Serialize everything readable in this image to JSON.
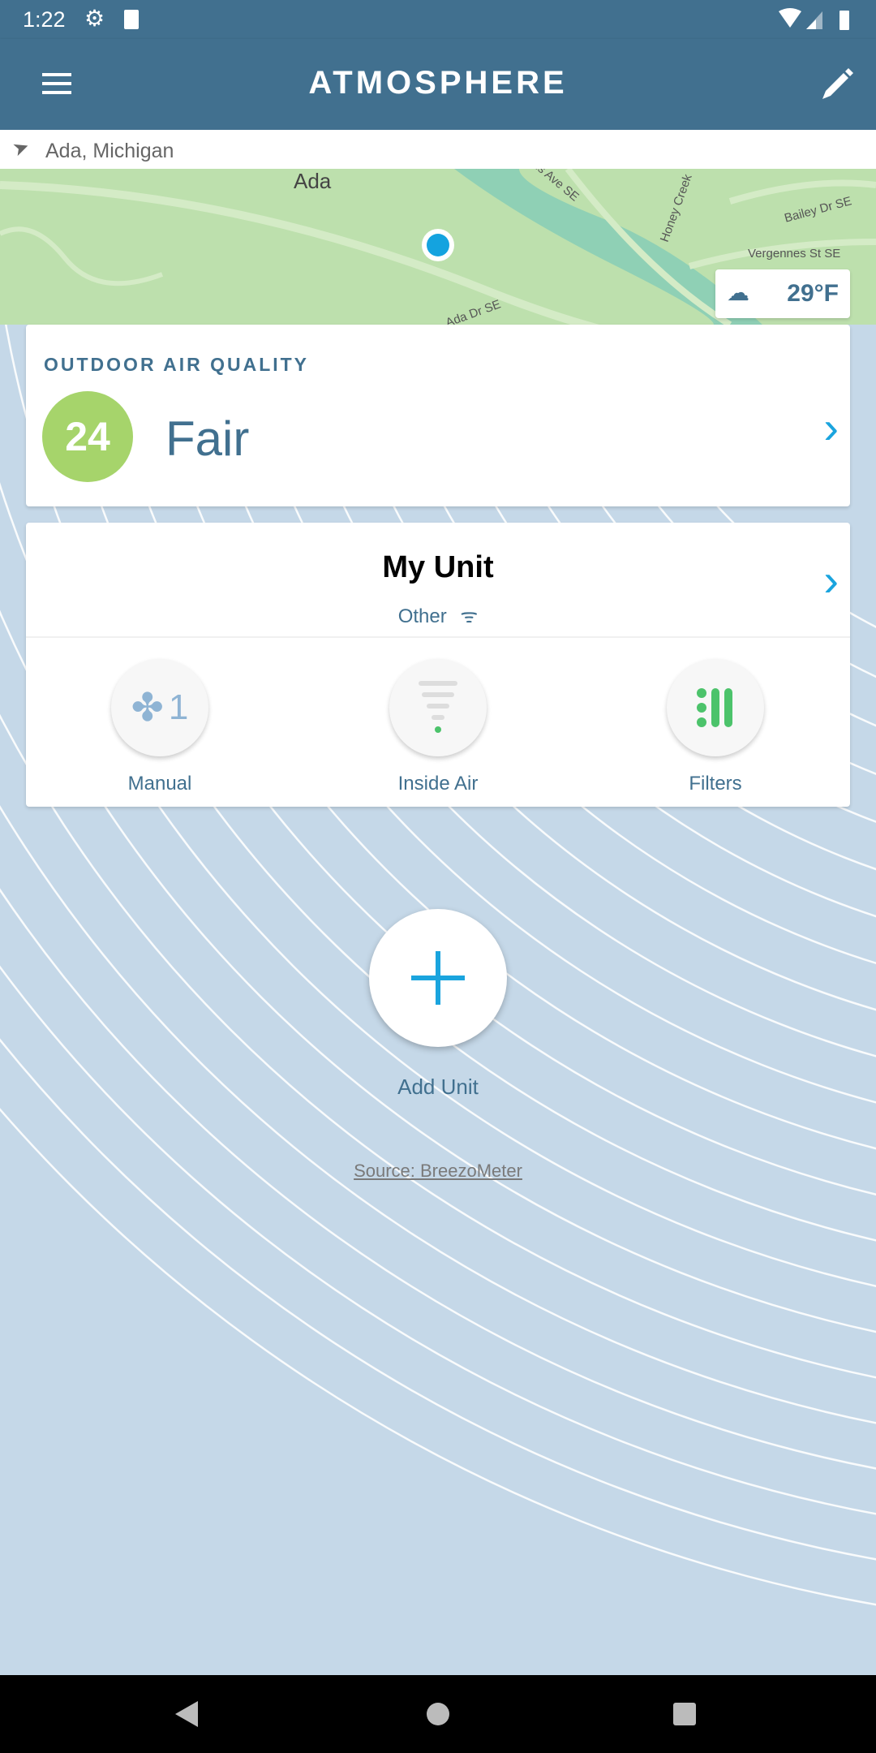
{
  "status_bar": {
    "time": "1:22"
  },
  "app_bar": {
    "title": "ATMOSPHERE",
    "menu_icon": "hamburger-icon",
    "edit_icon": "pencil-icon"
  },
  "location": {
    "label": "Ada, Michigan"
  },
  "map": {
    "labels": [
      "Ada",
      "Honey Creek",
      "Bailey Dr SE",
      "Vergennes St SE",
      "Ada Dr SE",
      "is Ave SE"
    ],
    "weather": {
      "temperature": "29°F",
      "icon": "cloud-icon"
    }
  },
  "air_quality": {
    "heading": "OUTDOOR AIR QUALITY",
    "index": "24",
    "rating": "Fair",
    "color": "#a6d46b"
  },
  "unit": {
    "name": "My Unit",
    "type": "Other",
    "controls": [
      {
        "label": "Manual",
        "value": "1"
      },
      {
        "label": "Inside Air"
      },
      {
        "label": "Filters"
      }
    ]
  },
  "add_unit": {
    "label": "Add Unit"
  },
  "source": {
    "label": "Source: BreezoMeter"
  },
  "colors": {
    "primary": "#41708f",
    "accent": "#1aa4de",
    "green": "#4cc36b"
  }
}
